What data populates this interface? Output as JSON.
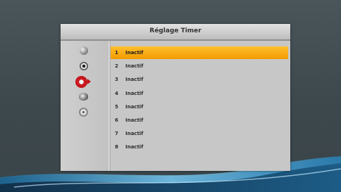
{
  "dialog": {
    "title": "Réglage Timer"
  },
  "side_icons": [
    {
      "icon": "globe-icon"
    },
    {
      "icon": "target-icon"
    },
    {
      "icon": "no-entry-icon",
      "selected": true
    },
    {
      "icon": "tv-icon"
    },
    {
      "icon": "film-reel-icon"
    }
  ],
  "timers": [
    {
      "num": "1",
      "label": "Inactif",
      "selected": true
    },
    {
      "num": "2",
      "label": "Inactif"
    },
    {
      "num": "3",
      "label": "Inactif"
    },
    {
      "num": "4",
      "label": "Inactif"
    },
    {
      "num": "5",
      "label": "Inactif"
    },
    {
      "num": "6",
      "label": "Inactif"
    },
    {
      "num": "7",
      "label": "Inactif"
    },
    {
      "num": "8",
      "label": "Inactif"
    }
  ],
  "colors": {
    "highlight": "#f6a600",
    "accent_red": "#c0161b"
  }
}
